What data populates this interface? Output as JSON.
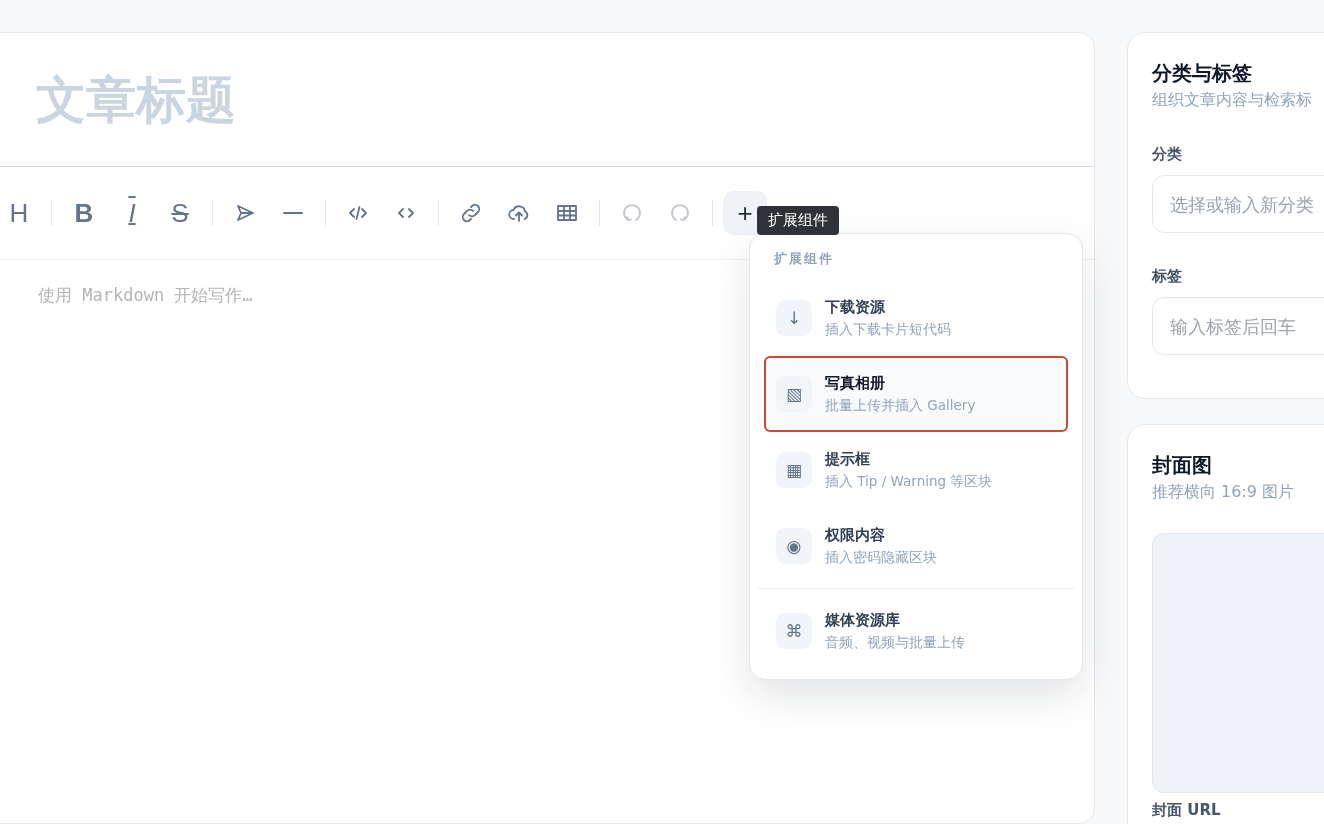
{
  "editor": {
    "title_placeholder": "文章标题",
    "body_placeholder": "使用 Markdown 开始写作…",
    "toolbar": [
      {
        "items": [
          {
            "kind": "heading",
            "label": "H",
            "disabled": false
          }
        ]
      },
      {
        "items": [
          {
            "kind": "bold",
            "label": "B",
            "disabled": false
          },
          {
            "kind": "italic",
            "label": "I",
            "disabled": false
          },
          {
            "kind": "strike",
            "label": "S",
            "disabled": false
          }
        ]
      },
      {
        "items": [
          {
            "kind": "send",
            "disabled": false
          },
          {
            "kind": "rule",
            "disabled": false
          }
        ]
      },
      {
        "items": [
          {
            "kind": "code-block",
            "disabled": false
          },
          {
            "kind": "code-inline",
            "disabled": false
          }
        ]
      },
      {
        "items": [
          {
            "kind": "link",
            "disabled": false
          },
          {
            "kind": "upload",
            "disabled": false
          },
          {
            "kind": "table",
            "disabled": false
          }
        ]
      },
      {
        "items": [
          {
            "kind": "undo",
            "disabled": true
          },
          {
            "kind": "redo",
            "disabled": true
          }
        ]
      },
      {
        "items": [
          {
            "kind": "extend",
            "label": "+",
            "disabled": false,
            "expanded": true,
            "tooltip": "扩展组件"
          }
        ]
      }
    ]
  },
  "extension_menu": {
    "heading": "扩展组件",
    "sections": [
      {
        "items": [
          {
            "icon": "↓",
            "title": "下载资源",
            "description": "插入下载卡片短代码",
            "selected": false
          },
          {
            "icon": "▧",
            "title": "写真相册",
            "description": "批量上传并插入 Gallery",
            "selected": true
          },
          {
            "icon": "▦",
            "title": "提示框",
            "description": "插入 Tip / Warning 等区块",
            "selected": false
          },
          {
            "icon": "◉",
            "title": "权限内容",
            "description": "插入密码隐藏区块",
            "selected": false
          }
        ]
      },
      {
        "items": [
          {
            "icon": "⌘",
            "title": "媒体资源库",
            "description": "音频、视频与批量上传",
            "selected": false
          }
        ]
      }
    ]
  },
  "sidebar": [
    {
      "title": "分类与标签",
      "subtitle": "组织文章内容与检索标",
      "fields": [
        {
          "label": "分类",
          "placeholder": "选择或输入新分类"
        },
        {
          "label": "标签",
          "placeholder": "输入标签后回车"
        }
      ]
    },
    {
      "title": "封面图",
      "subtitle": "推荐横向 16:9 图片",
      "cover": {
        "kind": "empty"
      },
      "fields": [
        {
          "label": "封面 URL"
        }
      ]
    }
  ]
}
